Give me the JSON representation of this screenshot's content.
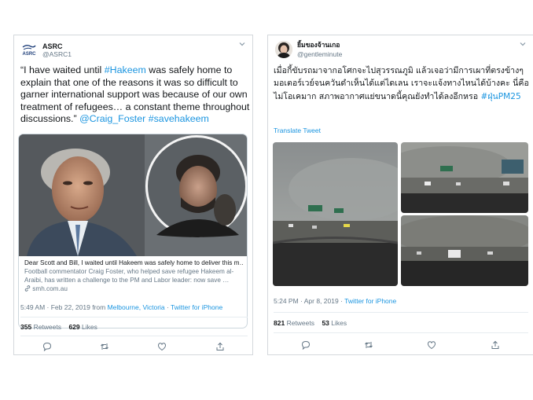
{
  "tweets": [
    {
      "author_name": "ASRC",
      "author_handle": "@ASRC1",
      "avatar_text": "ASRC",
      "body_prefix": "“I have waited until ",
      "body_hashtag1": "#Hakeem",
      "body_middle": " was safely home to explain that one of the reasons it was so difficult to garner international support was because of our own treatment of refugees… a constant theme throughout discussions.” ",
      "body_mention": "@Craig_Foster",
      "body_hashtag2": "#savehakeem",
      "card": {
        "title": "Dear Scott and Bill, I waited until Hakeem was safely home to deliver this m…",
        "description": "Football commentator Craig Foster, who helped save refugee Hakeem al-Araibi, has written a challenge to the PM and Labor leader: now save …",
        "url": "smh.com.au"
      },
      "meta_time": "5:49 AM · Feb 22, 2019 from ",
      "meta_location": "Melbourne, Victoria",
      "meta_sep": " · ",
      "meta_source": "Twitter for iPhone",
      "retweets_count": "355",
      "retweets_label": "Retweets",
      "likes_count": "629",
      "likes_label": "Likes"
    },
    {
      "author_name": "ยิ้มของจ้านเกอ",
      "author_handle": "@gentleminute",
      "body_text": "เมื่อกี้ขับรถมาจากอโศกจะไปสุวรรณภูมิ แล้วเจอว่ามีการเผาที่ตรงข้างๆมอเตอร์เวย์จนควันดำเห็นได้แต่ไดเลน เราจะแจ้งทางไหนได้บ้างคะ นี่คือไม่โอเคมาก สภาพอากาศแย่ขนาดนี้คุณยังทำได้ลงอีกหรอ ",
      "body_hashtag": "#ฝุ่นPM25",
      "translate_label": "Translate Tweet",
      "meta_time": "5:24 PM · Apr 8, 2019 · ",
      "meta_source": "Twitter for iPhone",
      "retweets_count": "821",
      "retweets_label": "Retweets",
      "likes_count": "53",
      "likes_label": "Likes"
    }
  ],
  "colors": {
    "link": "#1b95e0",
    "secondary_text": "#657786",
    "border": "#d4d8dc"
  },
  "icons": [
    "chevron-down-icon",
    "reply-icon",
    "retweet-icon",
    "like-icon",
    "share-icon",
    "link-icon"
  ]
}
